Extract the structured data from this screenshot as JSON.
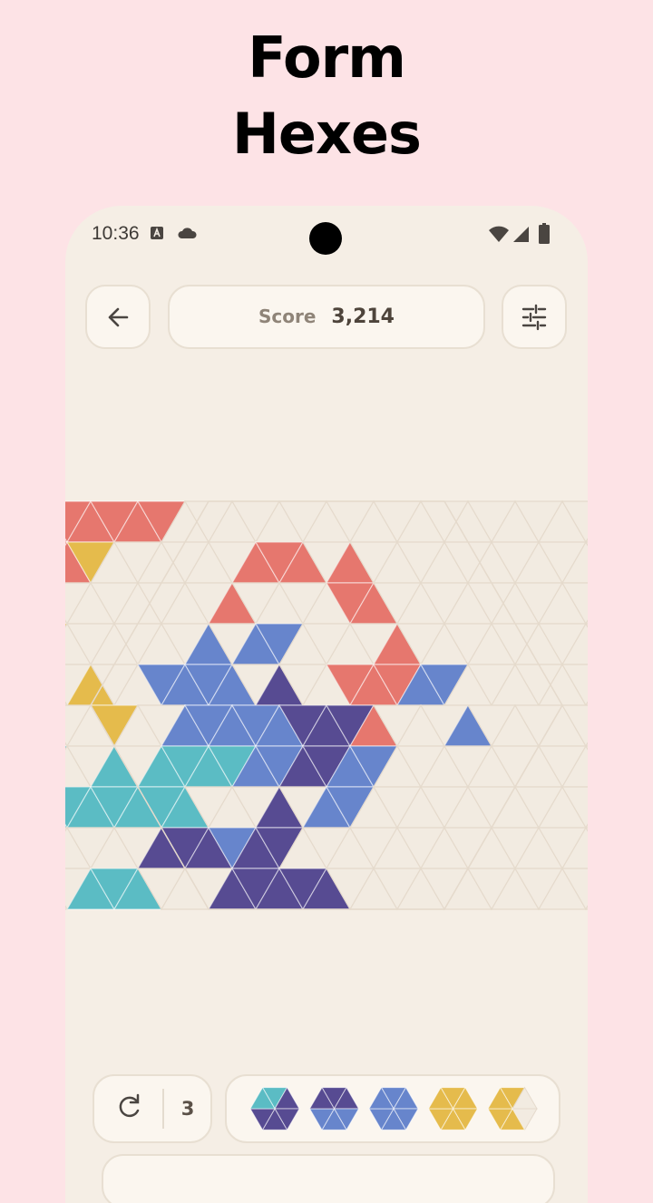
{
  "headline": {
    "line1": "Form",
    "line2": "Hexes"
  },
  "status_bar": {
    "time": "10:36"
  },
  "score": {
    "label": "Score",
    "value": "3,214"
  },
  "controls": {
    "moves_left": "3"
  },
  "palette": {
    "empty": "#f2ebe1",
    "red": "#e6776e",
    "yellow": "#e5bb4c",
    "teal": "#5bbcc4",
    "blue": "#6785cc",
    "purple": "#574b92",
    "grid_line": "#e5dacc"
  },
  "board": {
    "filled": [
      "0,0,1,red",
      "0,0,-1,red",
      "0,1,1,red",
      "0,1,-1,red",
      "0,2,1,red",
      "0,2,-1,red",
      "0,3,1,red",
      "0,3,-1,red",
      "1,1,-1,red",
      "1,2,1,red",
      "1,2,-1,yellow",
      "1,6,1,red",
      "1,6,-1,red",
      "1,7,1,red",
      "1,8,1,red",
      "2,1,1,red",
      "2,1,-1,red",
      "2,6,1,red",
      "2,8,-1,red",
      "2,9,1,red",
      "3,1,1,yellow",
      "3,1,-1,yellow",
      "3,2,1,yellow",
      "3,2,-1,yellow",
      "3,6,1,blue",
      "3,7,1,blue",
      "3,7,-1,blue",
      "3,10,1,red",
      "4,4,1,yellow",
      "4,5,-1,blue",
      "4,6,1,blue",
      "4,6,-1,blue",
      "4,7,1,blue",
      "4,8,1,purple",
      "4,9,-1,red",
      "4,10,1,red",
      "4,10,-1,red",
      "4,11,1,blue",
      "4,11,-1,blue",
      "5,1,1,teal",
      "5,1,-1,teal",
      "5,2,1,teal",
      "5,4,-1,yellow",
      "5,6,1,blue",
      "5,6,-1,blue",
      "5,7,1,blue",
      "5,7,-1,blue",
      "5,8,1,blue",
      "5,8,-1,purple",
      "5,9,1,purple",
      "5,9,-1,purple",
      "5,10,1,red",
      "5,12,1,blue",
      "6,2,-1,teal",
      "6,4,1,teal",
      "6,5,1,teal",
      "6,5,-1,teal",
      "6,6,1,teal",
      "6,6,-1,teal",
      "6,7,1,blue",
      "6,7,-1,blue",
      "6,8,1,purple",
      "6,8,-1,purple",
      "6,9,1,blue",
      "6,9,-1,blue",
      "7,1,1,teal",
      "7,1,-1,teal",
      "7,2,1,teal",
      "7,2,-1,teal",
      "7,3,1,teal",
      "7,3,-1,teal",
      "7,4,1,teal",
      "7,4,-1,teal",
      "7,5,1,teal",
      "7,7,1,purple",
      "7,8,1,blue",
      "7,8,-1,blue",
      "8,4,1,purple",
      "8,4,-1,purple",
      "8,5,1,purple",
      "8,5,-1,blue",
      "8,6,1,purple",
      "8,6,-1,purple",
      "9,2,1,teal",
      "9,2,-1,teal",
      "9,3,1,teal",
      "9,5,1,purple",
      "9,5,-1,purple",
      "9,6,1,purple",
      "9,6,-1,purple",
      "9,7,1,purple"
    ]
  },
  "tray_pieces": [
    {
      "name": "piece-1",
      "colors": [
        "teal",
        "purple",
        "purple",
        "purple",
        "purple",
        "teal"
      ]
    },
    {
      "name": "piece-2",
      "colors": [
        "purple",
        "purple",
        "blue",
        "blue",
        "blue",
        "purple"
      ]
    },
    {
      "name": "piece-3",
      "colors": [
        "blue",
        "blue",
        "blue",
        "blue",
        "blue",
        "blue"
      ]
    },
    {
      "name": "piece-4",
      "colors": [
        "yellow",
        "yellow",
        "yellow",
        "yellow",
        "yellow",
        "yellow"
      ]
    },
    {
      "name": "piece-5",
      "colors": [
        "yellow",
        "empty",
        "empty",
        "yellow",
        "yellow",
        "yellow"
      ]
    }
  ]
}
